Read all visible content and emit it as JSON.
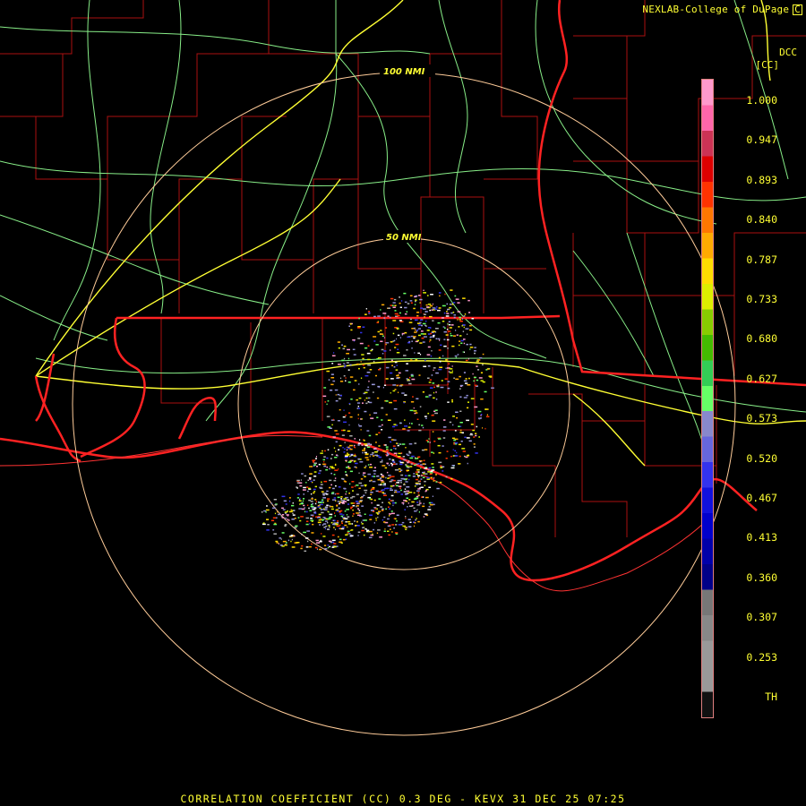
{
  "credit": "NEXLAB-College of DuPage",
  "credit_logo": "C",
  "station_tag": "DCC",
  "unit": "[CC]",
  "footer": "CORRELATION COEFFICIENT (CC) 0.3 DEG - KEVX 31 DEC 25 07:25",
  "rings": [
    {
      "label": "100 NMI"
    },
    {
      "label": "50 NMI"
    }
  ],
  "legend": {
    "ticks": [
      "1.000",
      "0.947",
      "0.893",
      "0.840",
      "0.787",
      "0.733",
      "0.680",
      "0.627",
      "0.573",
      "0.520",
      "0.467",
      "0.413",
      "0.360",
      "0.307",
      "0.253",
      "TH"
    ],
    "colors": [
      "#ff99cc",
      "#ff66aa",
      "#cc3355",
      "#dd0000",
      "#ff3300",
      "#ff7700",
      "#ffaa00",
      "#ffdd00",
      "#ddee00",
      "#88cc00",
      "#44bb00",
      "#33cc55",
      "#66ff66",
      "#8888cc",
      "#6666dd",
      "#3333ee",
      "#1111dd",
      "#0000cc",
      "#0000aa",
      "#000088",
      "#777777",
      "#888888",
      "#999999",
      "#999999",
      "#111111"
    ]
  },
  "colors": {
    "state_lines": "#ff2222",
    "county_lines": "#bb1111",
    "highways": "#88ee88",
    "interstates": "#ffff33",
    "rings": "#ffcc99"
  }
}
